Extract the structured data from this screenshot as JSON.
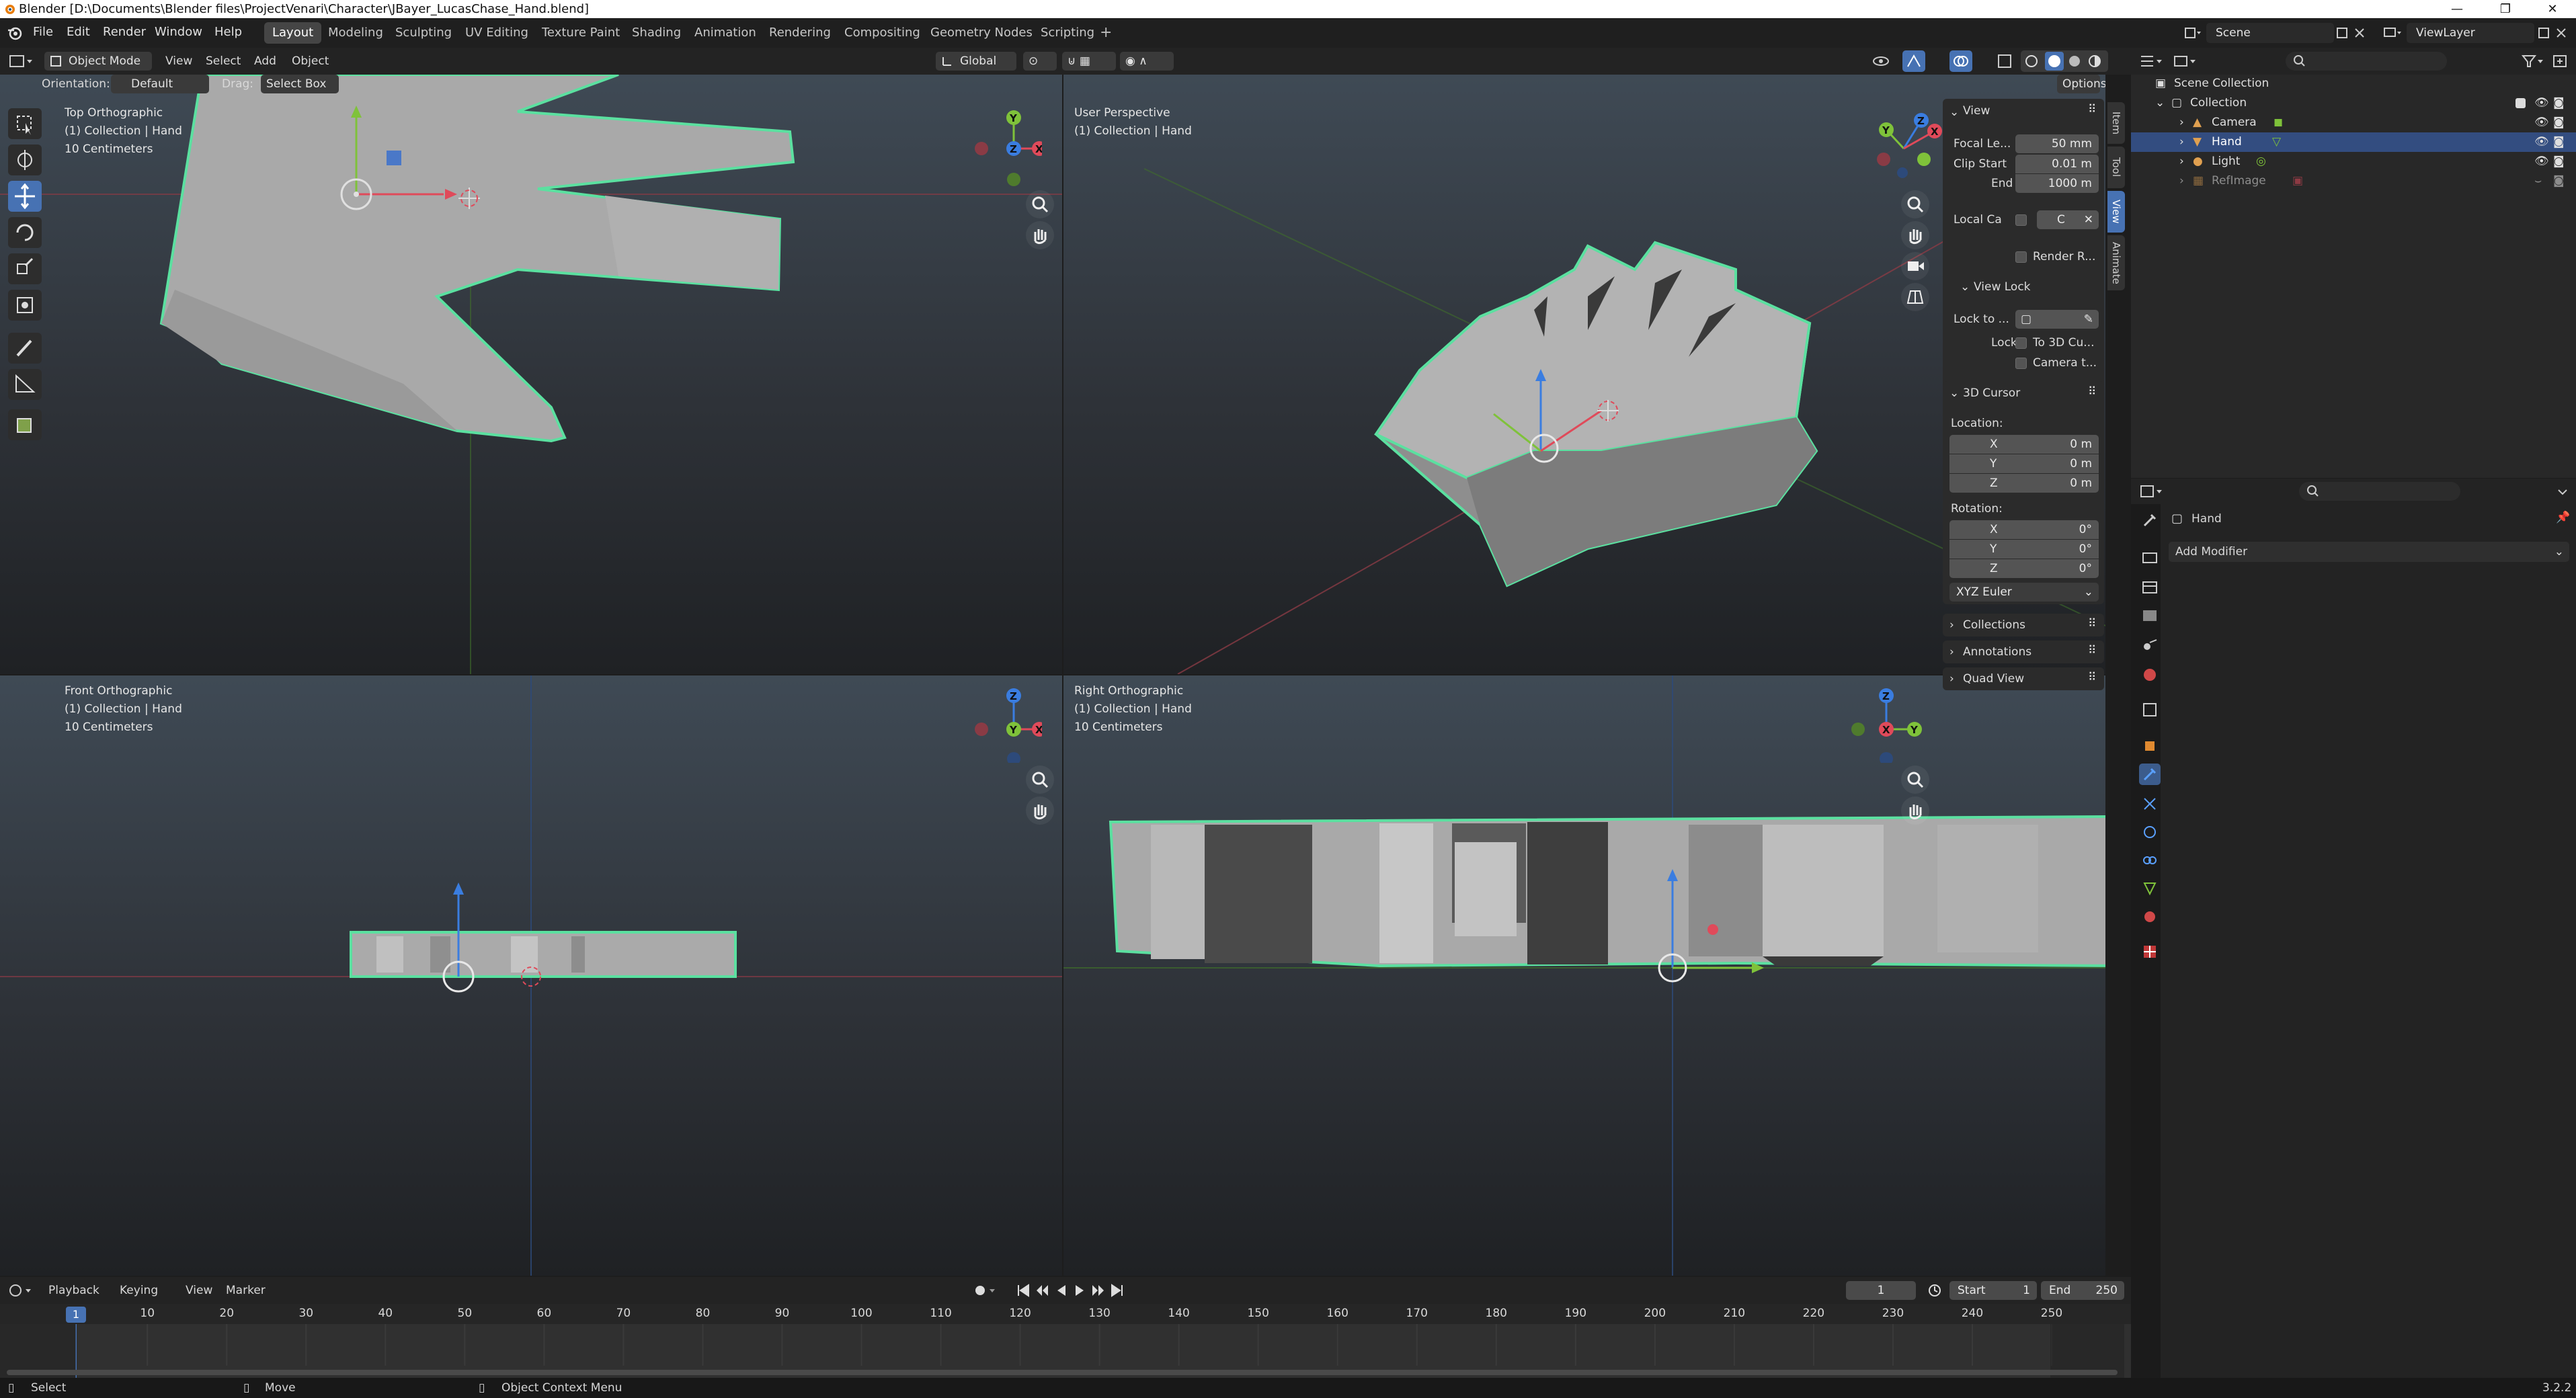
{
  "window": {
    "title": "Blender [D:\\Documents\\Blender files\\ProjectVenari\\Character\\JBayer_LucasChase_Hand.blend]",
    "controls": [
      "—",
      "❐",
      "✕"
    ]
  },
  "menubar": {
    "menus": [
      "File",
      "Edit",
      "Render",
      "Window",
      "Help"
    ],
    "workspaces": [
      "Layout",
      "Modeling",
      "Sculpting",
      "UV Editing",
      "Texture Paint",
      "Shading",
      "Animation",
      "Rendering",
      "Compositing",
      "Geometry Nodes",
      "Scripting"
    ],
    "active_workspace": "Layout",
    "add_workspace": "+",
    "scene": "Scene",
    "view_layer": "ViewLayer"
  },
  "viewport_header": {
    "mode": "Object Mode",
    "menus": [
      "View",
      "Select",
      "Add",
      "Object"
    ],
    "transform_orientation": "Global",
    "orientation_label": "Orientation:",
    "orientation_value": "Default",
    "drag_label": "Drag:",
    "drag_value": "Select Box",
    "options": "Options"
  },
  "viewports": {
    "top": {
      "title": "Top Orthographic",
      "collection": "(1) Collection | Hand",
      "scale": "10 Centimeters"
    },
    "user": {
      "title": "User Perspective",
      "collection": "(1) Collection | Hand"
    },
    "front": {
      "title": "Front Orthographic",
      "collection": "(1) Collection | Hand",
      "scale": "10 Centimeters"
    },
    "right": {
      "title": "Right Orthographic",
      "collection": "(1) Collection | Hand",
      "scale": "10 Centimeters"
    }
  },
  "gizmo_axes": {
    "top": {
      "a": "Y",
      "b": "Z",
      "c": "X"
    },
    "user": {
      "a": "Y",
      "b": "Z",
      "c": "X"
    },
    "front": {
      "a": "Z",
      "b": "Y",
      "c": "X"
    },
    "right": {
      "a": "Z",
      "b": "X",
      "c": "Y"
    }
  },
  "npanel": {
    "view": {
      "header": "View",
      "focal_label": "Focal Le...",
      "focal_value": "50 mm",
      "clip_start_label": "Clip Start",
      "clip_start_value": "0.01 m",
      "end_label": "End",
      "end_value": "1000 m",
      "local_camera_label": "Local Ca",
      "local_camera_value": "C",
      "render_region": "Render R...",
      "view_lock_header": "View Lock",
      "lock_to_label": "Lock to ...",
      "lock_label": "Lock",
      "to_3d_cursor": "To 3D Cu...",
      "camera_to_view": "Camera t..."
    },
    "cursor": {
      "header": "3D Cursor",
      "location_label": "Location:",
      "x_label": "X",
      "x_value": "0 m",
      "y_label": "Y",
      "y_value": "0 m",
      "z_label": "Z",
      "z_value": "0 m",
      "rotation_label": "Rotation:",
      "rx_label": "X",
      "rx_value": "0°",
      "ry_label": "Y",
      "ry_value": "0°",
      "rz_label": "Z",
      "rz_value": "0°",
      "rotation_mode": "XYZ Euler"
    },
    "collections": "Collections",
    "annotations": "Annotations",
    "quad_view": "Quad View",
    "tabs": [
      "Item",
      "Tool",
      "View",
      "Animate"
    ],
    "active_tab": "View"
  },
  "outliner": {
    "rows": [
      {
        "label": "Scene Collection"
      },
      {
        "label": "Collection"
      },
      {
        "label": "Camera"
      },
      {
        "label": "Hand"
      },
      {
        "label": "Light"
      },
      {
        "label": "RefImage"
      }
    ],
    "selected": "Hand"
  },
  "properties": {
    "object_name": "Hand",
    "add_modifier": "Add Modifier"
  },
  "timeline": {
    "menus": [
      "Playback",
      "Keying",
      "View",
      "Marker"
    ],
    "current_frame": "1",
    "start_label": "Start",
    "start_value": "1",
    "end_label": "End",
    "end_value": "250",
    "ticks": [
      "1",
      "10",
      "20",
      "30",
      "40",
      "50",
      "60",
      "70",
      "80",
      "90",
      "100",
      "110",
      "120",
      "130",
      "140",
      "150",
      "160",
      "170",
      "180",
      "190",
      "200",
      "210",
      "220",
      "230",
      "240",
      "250"
    ]
  },
  "statusbar": {
    "select": "Select",
    "move": "Move",
    "context_menu": "Object Context Menu",
    "version": "3.2.2"
  },
  "colors": {
    "accent": "#4772b3",
    "selection_outline": "#5be0a0",
    "axis_x": "#e04a5a",
    "axis_y": "#7fc23a",
    "axis_z": "#3a7de0",
    "mesh": "#a8a8a8"
  }
}
